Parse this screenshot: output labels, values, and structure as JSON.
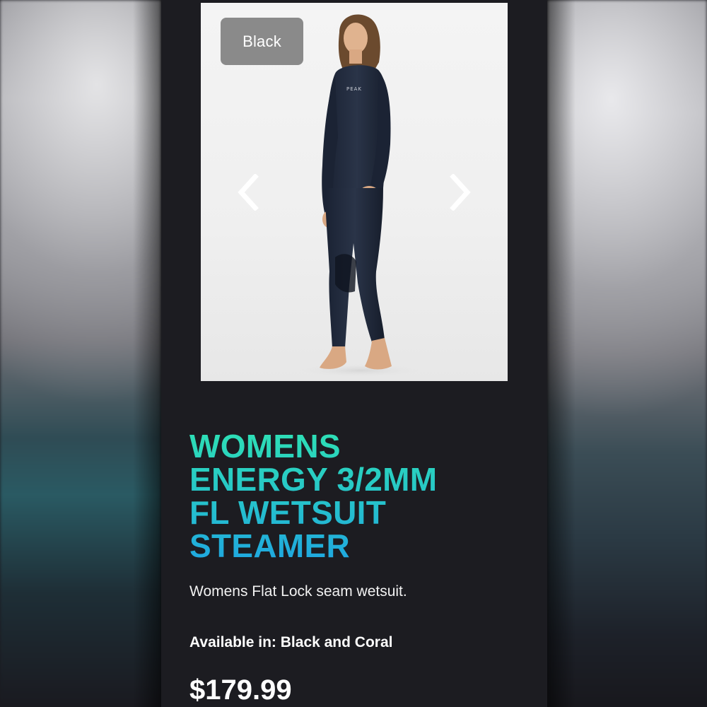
{
  "product": {
    "image": {
      "color_badge": "Black",
      "prev_icon": "chevron-left-icon",
      "next_icon": "chevron-right-icon",
      "logo_text": "PEAK"
    },
    "title_lines": [
      "WOMENS",
      "ENERGY 3/2MM",
      "FL WETSUIT",
      "STEAMER"
    ],
    "description": "Womens Flat Lock seam wetsuit.",
    "availability": "Available in: Black and Coral",
    "price": "$179.99"
  },
  "colors": {
    "background": "#1c1c21",
    "title_gradient_top": "#2ee0b5",
    "title_gradient_bottom": "#1fa7e0",
    "badge": "#8a8a8a",
    "text": "#ffffff"
  }
}
